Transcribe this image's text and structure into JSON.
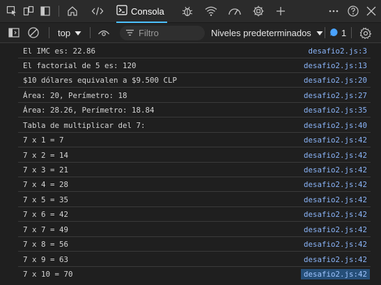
{
  "tabbar": {
    "console_label": "Consola",
    "icons": [
      "inspect-icon",
      "device-emulation-icon",
      "panel-toggle-icon",
      "home-icon",
      "code-icon",
      "console-icon",
      "bug-icon",
      "wifi-icon",
      "performance-icon",
      "gear-chip-icon",
      "plus-icon",
      "more-icon",
      "help-icon",
      "close-icon"
    ]
  },
  "toolbar": {
    "context": "top",
    "filter_placeholder": "Filtro",
    "levels": "Niveles predeterminados",
    "issues_count": "1"
  },
  "console": {
    "rows": [
      {
        "msg": "El IMC es: 22.86",
        "src": "desafio2.js:3"
      },
      {
        "msg": "El factorial de 5 es: 120",
        "src": "desafio2.js:13"
      },
      {
        "msg": "$10 dólares equivalen a $9.500 CLP",
        "src": "desafio2.js:20"
      },
      {
        "msg": "Área: 20, Perímetro: 18",
        "src": "desafio2.js:27"
      },
      {
        "msg": "Área: 28.26, Perímetro: 18.84",
        "src": "desafio2.js:35"
      },
      {
        "msg": "Tabla de multiplicar del 7:",
        "src": "desafio2.js:40"
      },
      {
        "msg": "7 x 1 = 7",
        "src": "desafio2.js:42"
      },
      {
        "msg": "7 x 2 = 14",
        "src": "desafio2.js:42"
      },
      {
        "msg": "7 x 3 = 21",
        "src": "desafio2.js:42"
      },
      {
        "msg": "7 x 4 = 28",
        "src": "desafio2.js:42"
      },
      {
        "msg": "7 x 5 = 35",
        "src": "desafio2.js:42"
      },
      {
        "msg": "7 x 6 = 42",
        "src": "desafio2.js:42"
      },
      {
        "msg": "7 x 7 = 49",
        "src": "desafio2.js:42"
      },
      {
        "msg": "7 x 8 = 56",
        "src": "desafio2.js:42"
      },
      {
        "msg": "7 x 9 = 63",
        "src": "desafio2.js:42"
      },
      {
        "msg": "7 x 10 = 70",
        "src": "desafio2.js:42"
      }
    ]
  },
  "colors": {
    "accent": "#4cc2ff",
    "link": "#8ab4f8",
    "selection": "#264f78"
  }
}
